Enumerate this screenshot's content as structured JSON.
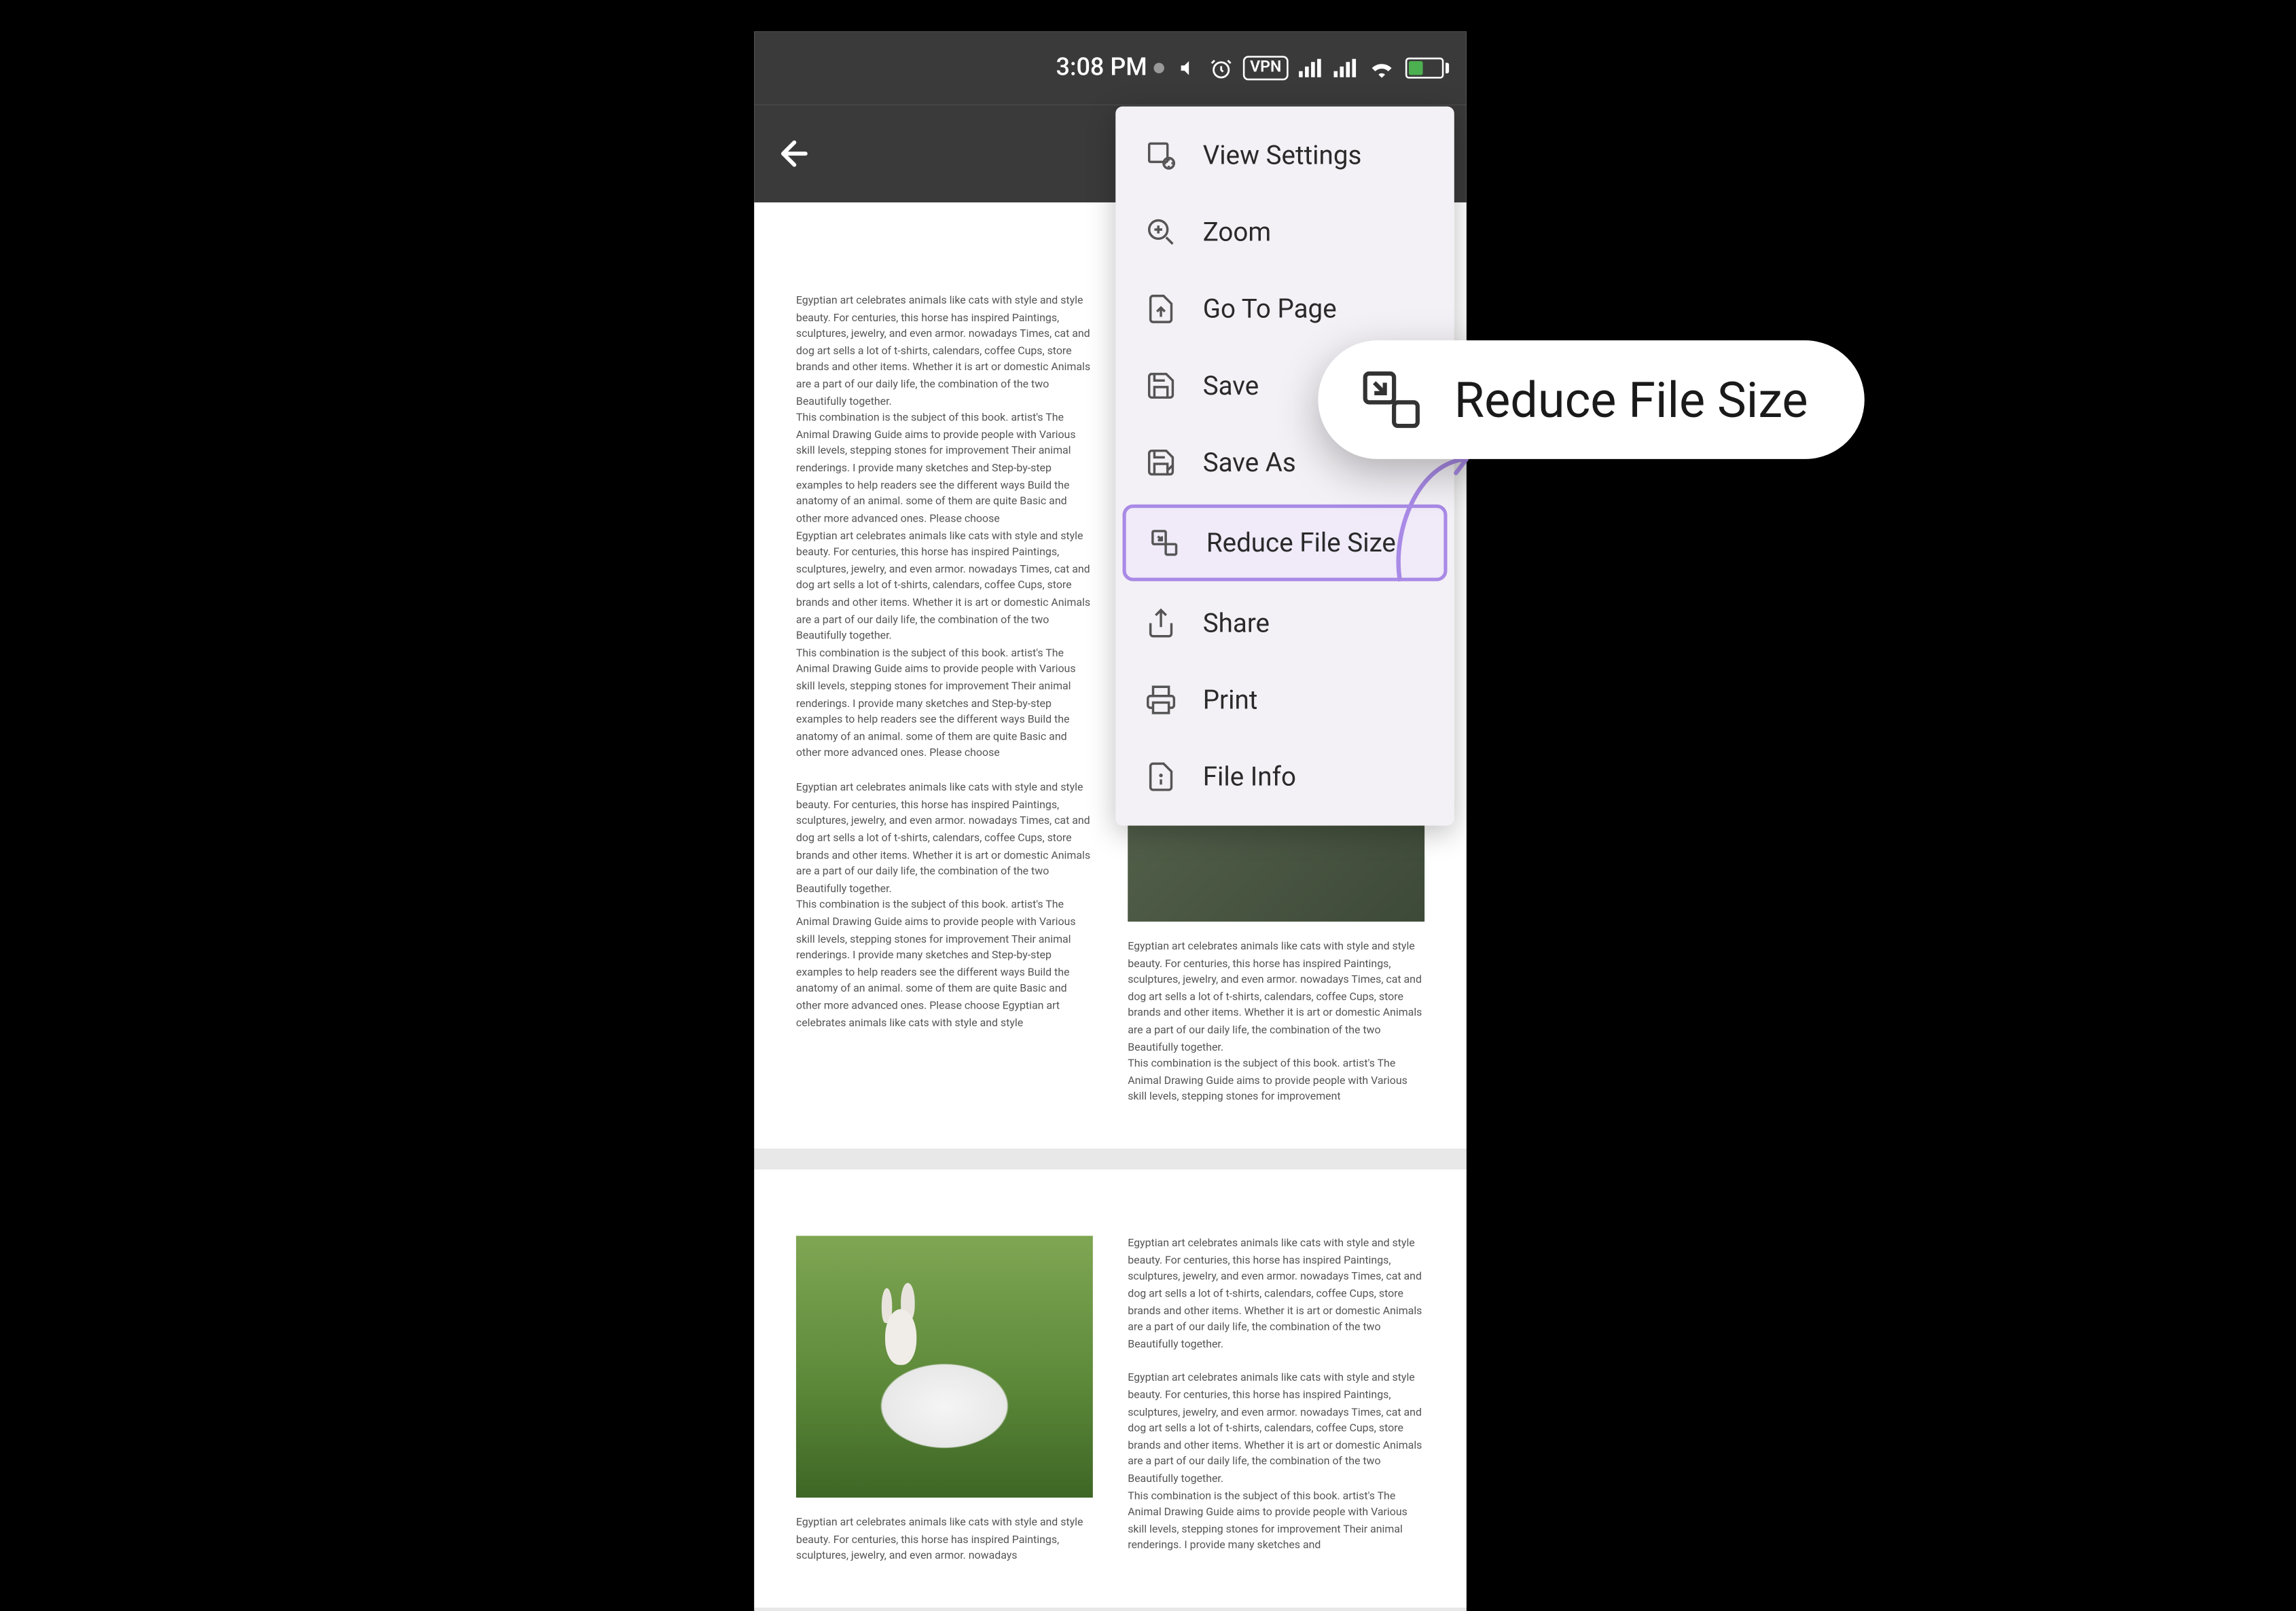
{
  "status": {
    "time": "3:08 PM",
    "vpn": "VPN"
  },
  "menu": {
    "view_settings": "View Settings",
    "zoom": "Zoom",
    "go_to_page": "Go To Page",
    "save": "Save",
    "save_as": "Save As",
    "reduce_file_size": "Reduce File Size",
    "share": "Share",
    "print": "Print",
    "file_info": "File Info"
  },
  "callout": {
    "label": "Reduce File Size"
  },
  "doc": {
    "block1": "Egyptian art celebrates animals like cats with style and style beauty. For centuries, this horse has inspired Paintings, sculptures, jewelry, and even armor. nowadays Times, cat and dog art sells a lot of t-shirts, calendars, coffee Cups, store brands and other items. Whether it is art or domestic Animals are a part of our daily life, the combination of the two Beautifully together.",
    "block2": "This combination is the subject of this book. artist's The Animal Drawing Guide aims to provide people with Various skill levels, stepping stones for improvement Their animal renderings. I provide many sketches and Step-by-step examples to help readers see the different ways Build the anatomy of an animal. some of them are quite Basic and other more advanced ones. Please choose",
    "block3": "Egyptian art celebrates animals like cats with style and style beauty. For centuries, this horse has inspired Paintings, sculptures, jewelry, and even armor. nowadays Times, cat and dog art sells a lot of t-shirts, calendars, coffee Cups, store brands and other items. Whether it is art or domestic Animals are a part of our daily life, the combination of the two Beautifully together.",
    "block4": "This combination is the subject of this book. artist's The Animal Drawing Guide aims to provide people with Various skill levels, stepping stones for improvement Their animal renderings. I provide many sketches and Step-by-step examples to help readers see the different ways Build the anatomy of an animal. some of them are quite Basic and other more advanced ones. Please choose",
    "block5": "Egyptian art celebrates animals like cats with style and style beauty. For centuries, this horse has inspired Paintings, sculptures, jewelry, and even armor. nowadays Times, cat and dog art sells a lot of t-shirts, calendars, coffee Cups, store brands and other items. Whether it is art or domestic Animals are a part of our daily life, the combination of the two Beautifully together.",
    "block6": "This combination is the subject of this book. artist's The Animal Drawing Guide aims to provide people with Various skill levels, stepping stones for improvement Their animal renderings. I provide many sketches and Step-by-step examples to help readers see the different ways Build the anatomy of an animal. some of them are quite Basic and other more advanced ones. Please choose Egyptian art celebrates animals like cats with style and style",
    "r_block1": "Egyptian art celebrates animals like cats with style and style beauty. For centuries, this horse has inspired Paintings, sculptures, jewelry, and even armor. nowadays Times, cat and dog art sells a lot of t-shirts, calendars, coffee Cups, store brands and other items. Whether it is art or domestic Animals are a part of our daily life, the combination of the two Beautifully together.",
    "r_block2": "This combination is the subject of this book. artist's The Animal Drawing Guide aims to provide people with Various skill levels, stepping stones for improvement",
    "p2_r1": "Egyptian art celebrates animals like cats with style and style beauty. For centuries, this horse has inspired Paintings, sculptures, jewelry, and even armor. nowadays Times, cat and dog art sells a lot of t-shirts, calendars, coffee Cups, store brands and other items. Whether it is art or domestic Animals are a part of our daily life, the combination of the two Beautifully together.",
    "p2_r2": "Egyptian art celebrates animals like cats with style and style beauty. For centuries, this horse has inspired Paintings, sculptures, jewelry, and even armor. nowadays Times, cat and dog art sells a lot of t-shirts, calendars, coffee Cups, store brands and other items. Whether it is art or domestic Animals are a part of our daily life, the combination of the two Beautifully together.",
    "p2_r3": "This combination is the subject of this book. artist's The Animal Drawing Guide aims to provide people with Various skill levels, stepping stones for improvement Their animal renderings. I provide many sketches and",
    "p2_l1": "Egyptian art celebrates animals like cats with style and style beauty. For centuries, this horse has inspired Paintings, sculptures, jewelry, and even armor. nowadays"
  }
}
